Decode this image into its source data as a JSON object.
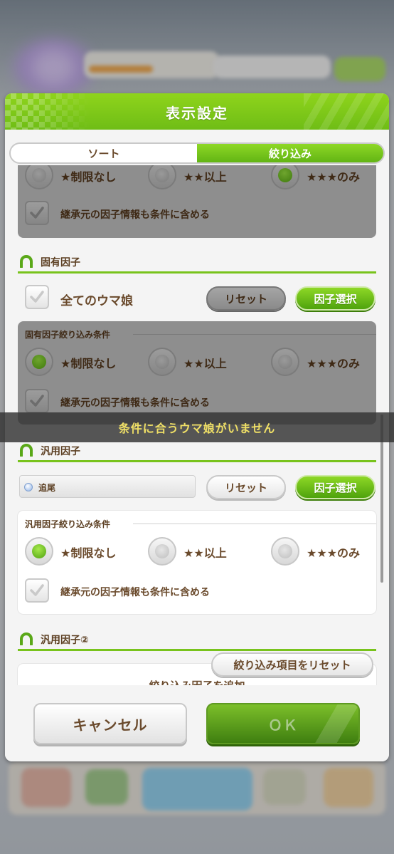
{
  "dialog": {
    "title": "表示設定",
    "tabs": [
      {
        "label": "ソート",
        "active": false
      },
      {
        "label": "絞り込み",
        "active": true
      }
    ]
  },
  "rarity_options": [
    "★制限なし",
    "★★以上",
    "★★★のみ"
  ],
  "top_filter": {
    "selected_index": 2,
    "inherit_label": "継承元の因子情報も条件に含める",
    "inherit_checked": true
  },
  "unique_factor": {
    "heading": "固有因子",
    "all_uma_label": "全てのウマ娘",
    "all_uma_checked": true,
    "reset_label": "リセット",
    "select_label": "因子選択",
    "conditions_title": "固有因子絞り込み条件",
    "selected_index": 0,
    "inherit_label": "継承元の因子情報も条件に含める",
    "inherit_checked": true
  },
  "general_factor": {
    "heading": "汎用因子",
    "selected_factor": "追尾",
    "reset_label": "リセット",
    "select_label": "因子選択",
    "conditions_title": "汎用因子絞り込み条件",
    "selected_index": 0,
    "inherit_label": "継承元の因子情報も条件に含める",
    "inherit_checked": true
  },
  "general_factor_2": {
    "heading": "汎用因子②",
    "add_label": "絞り込み因子を追加"
  },
  "reset_all_label": "絞り込み項目をリセット",
  "footer": {
    "cancel_label": "キャンセル",
    "ok_label": "ＯＫ"
  },
  "toast": "条件に合うウマ娘がいません",
  "colors": {
    "accent_green": "#78c31c",
    "text_brown": "#6a4a2c",
    "toast_text": "#f0e066"
  }
}
